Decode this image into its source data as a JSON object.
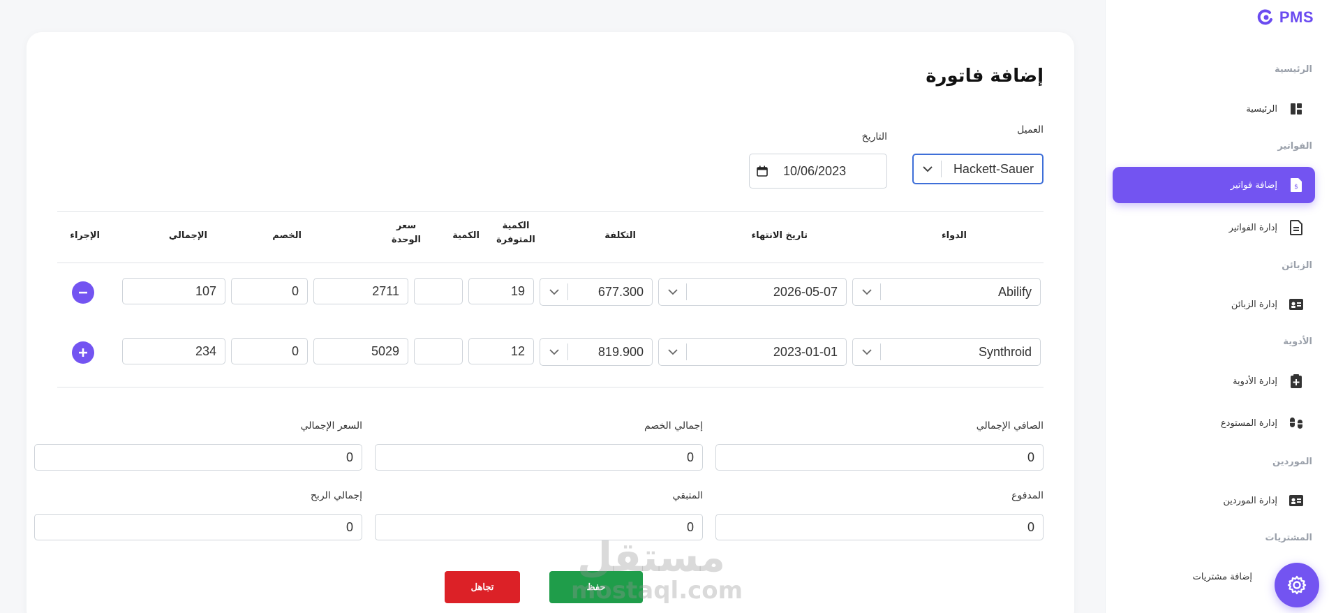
{
  "sidebar": {
    "brand": "PMS",
    "sections": {
      "home": "الرئيسية",
      "invoices": "الفواتير",
      "customers": "الزبائن",
      "medicines": "الأدوية",
      "suppliers": "الموردين",
      "purchases": "المشتريات"
    },
    "items": {
      "home": "الرئيسية",
      "add_invoices": "إضافة فواتير",
      "manage_invoices": "إدارة الفواتير",
      "manage_customers": "إدارة الزبائن",
      "manage_medicines": "إدارة الأدوية",
      "manage_warehouse": "إدارة المستودع",
      "manage_suppliers": "إدارة الموردين",
      "add_purchases": "إضافة مشتريات"
    },
    "accent": "#7354f1"
  },
  "form": {
    "title": "إضافة فاتورة",
    "customer_label": "العميل",
    "customer_value": "Hackett-Sauer",
    "date_label": "التاريخ",
    "date_value": "10/06/2023"
  },
  "table": {
    "headers": {
      "medicine": "الدواء",
      "expiry": "تاريخ الانتهاء",
      "cost": "التكلفة",
      "available_qty_1": "الكمية",
      "available_qty_2": "المتوفرة",
      "qty": "الكمية",
      "unit_price_1": "سعر",
      "unit_price_2": "الوحدة",
      "discount": "الخصم",
      "total": "الإجمالي",
      "action": "الإجراء"
    },
    "rows": [
      {
        "medicine": "Abilify",
        "expiry": "2026-05-07",
        "cost": "677.300",
        "available": "19",
        "qty": "",
        "unit_price": "2711",
        "discount": "0",
        "total": "107"
      },
      {
        "medicine": "Synthroid",
        "expiry": "2023-01-01",
        "cost": "819.900",
        "available": "12",
        "qty": "",
        "unit_price": "5029",
        "discount": "0",
        "total": "234"
      }
    ]
  },
  "summary": {
    "net_total_label": "الصافي الإجمالي",
    "net_total": "0",
    "discount_total_label": "إجمالي الخصم",
    "discount_total": "0",
    "price_total_label": "السعر الإجمالي",
    "price_total": "0",
    "paid_label": "المدفوع",
    "paid": "0",
    "remaining_label": "المتبقي",
    "remaining": "0",
    "profit_total_label": "إجمالي الربح",
    "profit_total": "0"
  },
  "actions": {
    "save": "حفظ",
    "cancel": "تجاهل"
  },
  "watermark": {
    "ar": "مستقل",
    "en": "mostaql.com"
  },
  "colors": {
    "primary": "#7354f1",
    "save": "#1f9d4a",
    "cancel": "#dc2127"
  }
}
